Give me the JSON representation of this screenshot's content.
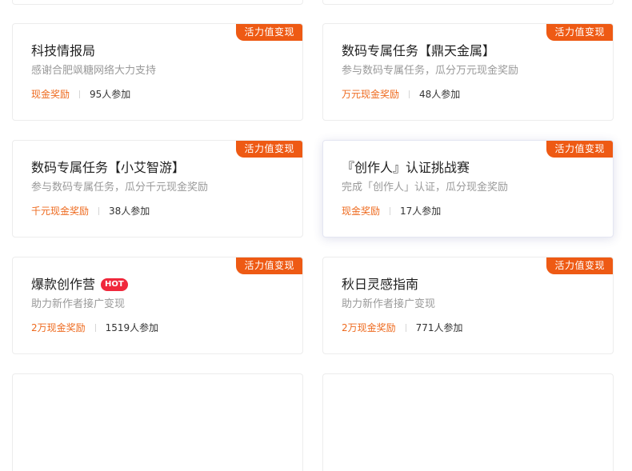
{
  "cards": [
    {
      "tag": "活力值变现",
      "title": "科技情报局",
      "desc": "感谢合肥飒糖网络大力支持",
      "reward": "现金奖励",
      "count": "95人参加"
    },
    {
      "tag": "活力值变现",
      "title": "数码专属任务【鼎天金属】",
      "desc": "参与数码专属任务，瓜分万元现金奖励",
      "reward": "万元现金奖励",
      "count": "48人参加"
    },
    {
      "tag": "活力值变现",
      "title": "数码专属任务【小艾智游】",
      "desc": "参与数码专属任务，瓜分千元现金奖励",
      "reward": "千元现金奖励",
      "count": "38人参加"
    },
    {
      "tag": "活力值变现",
      "title": "『创作人』认证挑战赛",
      "desc": "完成「创作人」认证，瓜分现金奖励",
      "reward": "现金奖励",
      "count": "17人参加"
    },
    {
      "tag": "活力值变现",
      "title": "爆款创作营",
      "badge": "HOT",
      "desc": "助力新作者接广变现",
      "reward": "2万现金奖励",
      "count": "1519人参加"
    },
    {
      "tag": "活力值变现",
      "title": "秋日灵感指南",
      "desc": "助力新作者接广变现",
      "reward": "2万现金奖励",
      "count": "771人参加"
    }
  ]
}
